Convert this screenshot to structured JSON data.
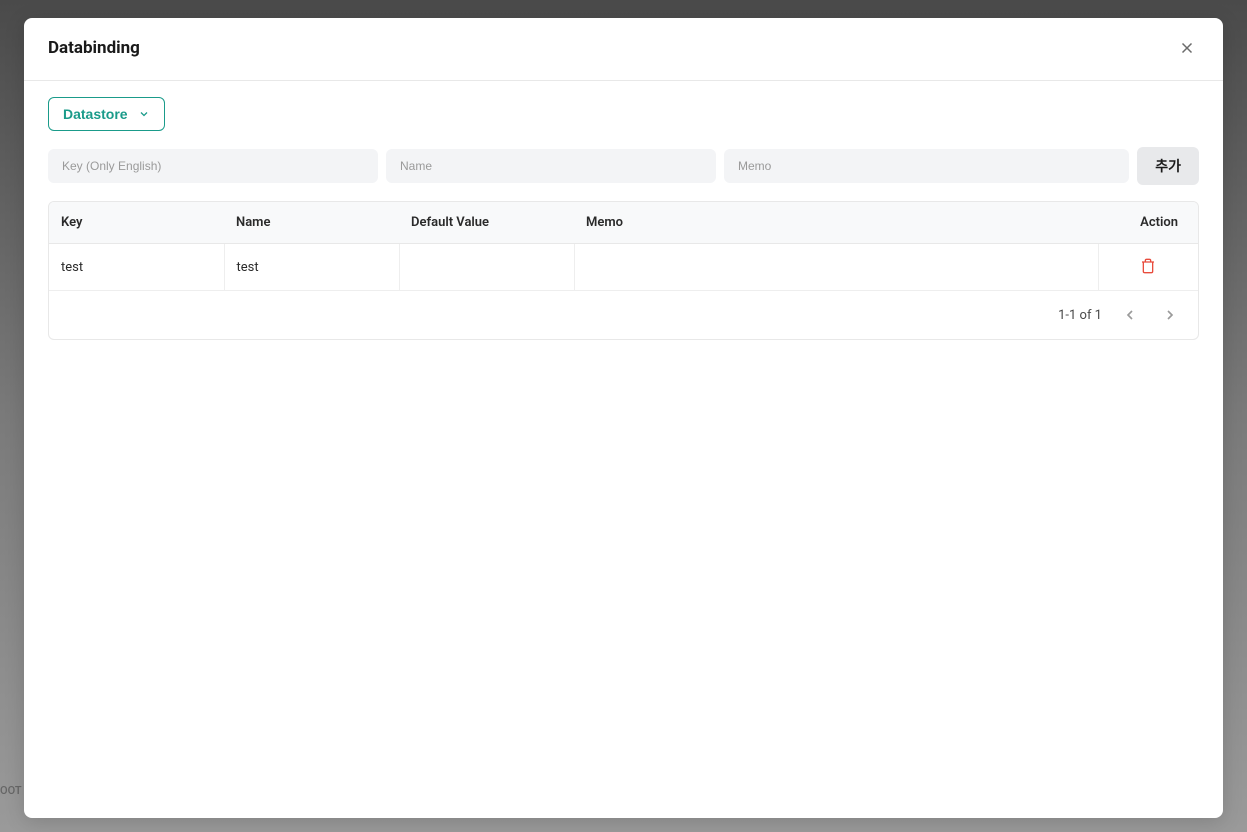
{
  "modal": {
    "title": "Databinding"
  },
  "dropdown": {
    "label": "Datastore"
  },
  "inputs": {
    "key_placeholder": "Key (Only English)",
    "name_placeholder": "Name",
    "memo_placeholder": "Memo",
    "add_button": "추가"
  },
  "table": {
    "headers": {
      "key": "Key",
      "name": "Name",
      "default_value": "Default Value",
      "memo": "Memo",
      "action": "Action"
    },
    "rows": [
      {
        "key": "test",
        "name": "test",
        "default_value": "",
        "memo": ""
      }
    ]
  },
  "pagination": {
    "text": "1-1 of 1"
  },
  "background": {
    "text": "OOT"
  }
}
